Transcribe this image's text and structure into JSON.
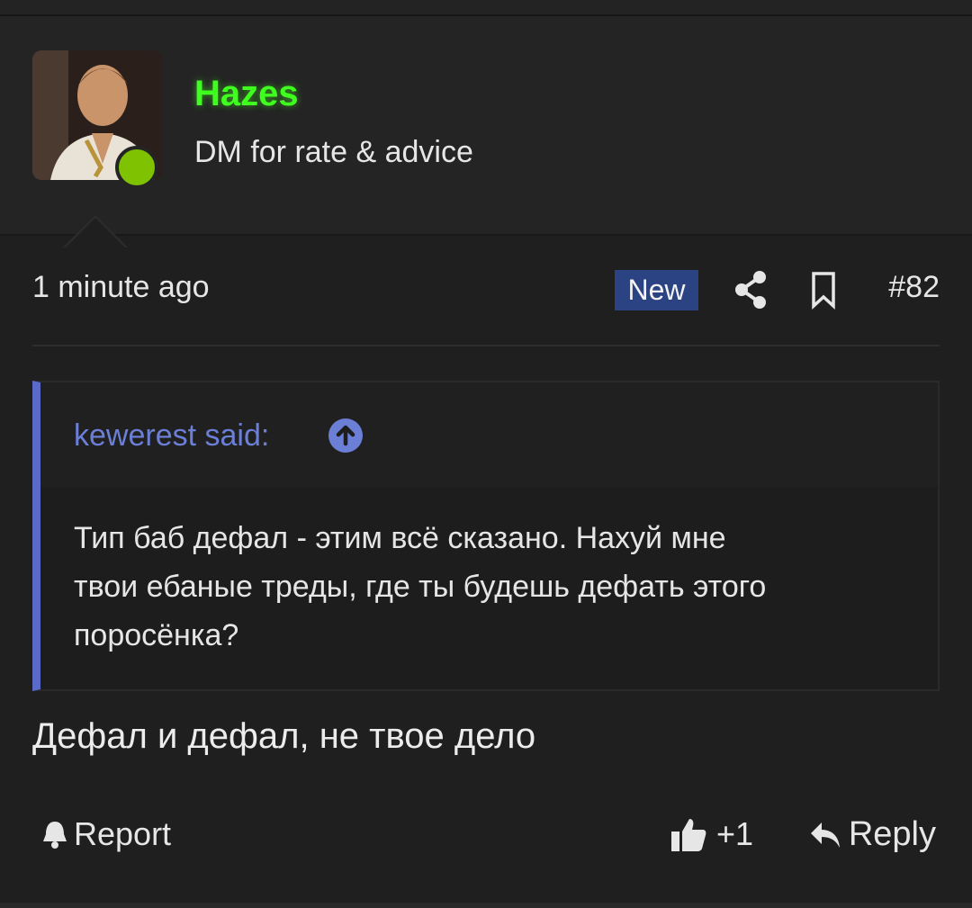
{
  "post": {
    "author": {
      "name": "Hazes",
      "title": "DM for rate & advice",
      "name_color": "#3eff1e",
      "online": true,
      "status_color": "#7fc202"
    },
    "time": "1 minute ago",
    "badge": "New",
    "badge_color": "#2b4283",
    "share_icon": "share-icon",
    "bookmark_icon": "bookmark-icon",
    "number": "#82",
    "quote": {
      "author_label": "kewerest said:",
      "accent_color": "#5a6ac9",
      "jump_icon": "arrow-up-circle-icon",
      "lines": [
        "Тип баб дефал - этим всё сказано. Нахуй мне",
        "твои ебаные треды, где ты будешь дефать этого",
        "поросёнка?"
      ]
    },
    "message": "Дефал и дефал, не твое дело",
    "actions": {
      "report_label": "Report",
      "report_icon": "bell-icon",
      "like_icon": "thumbs-up-icon",
      "like_label": "+1",
      "reply_icon": "reply-arrow-icon",
      "reply_label": "Reply"
    }
  }
}
